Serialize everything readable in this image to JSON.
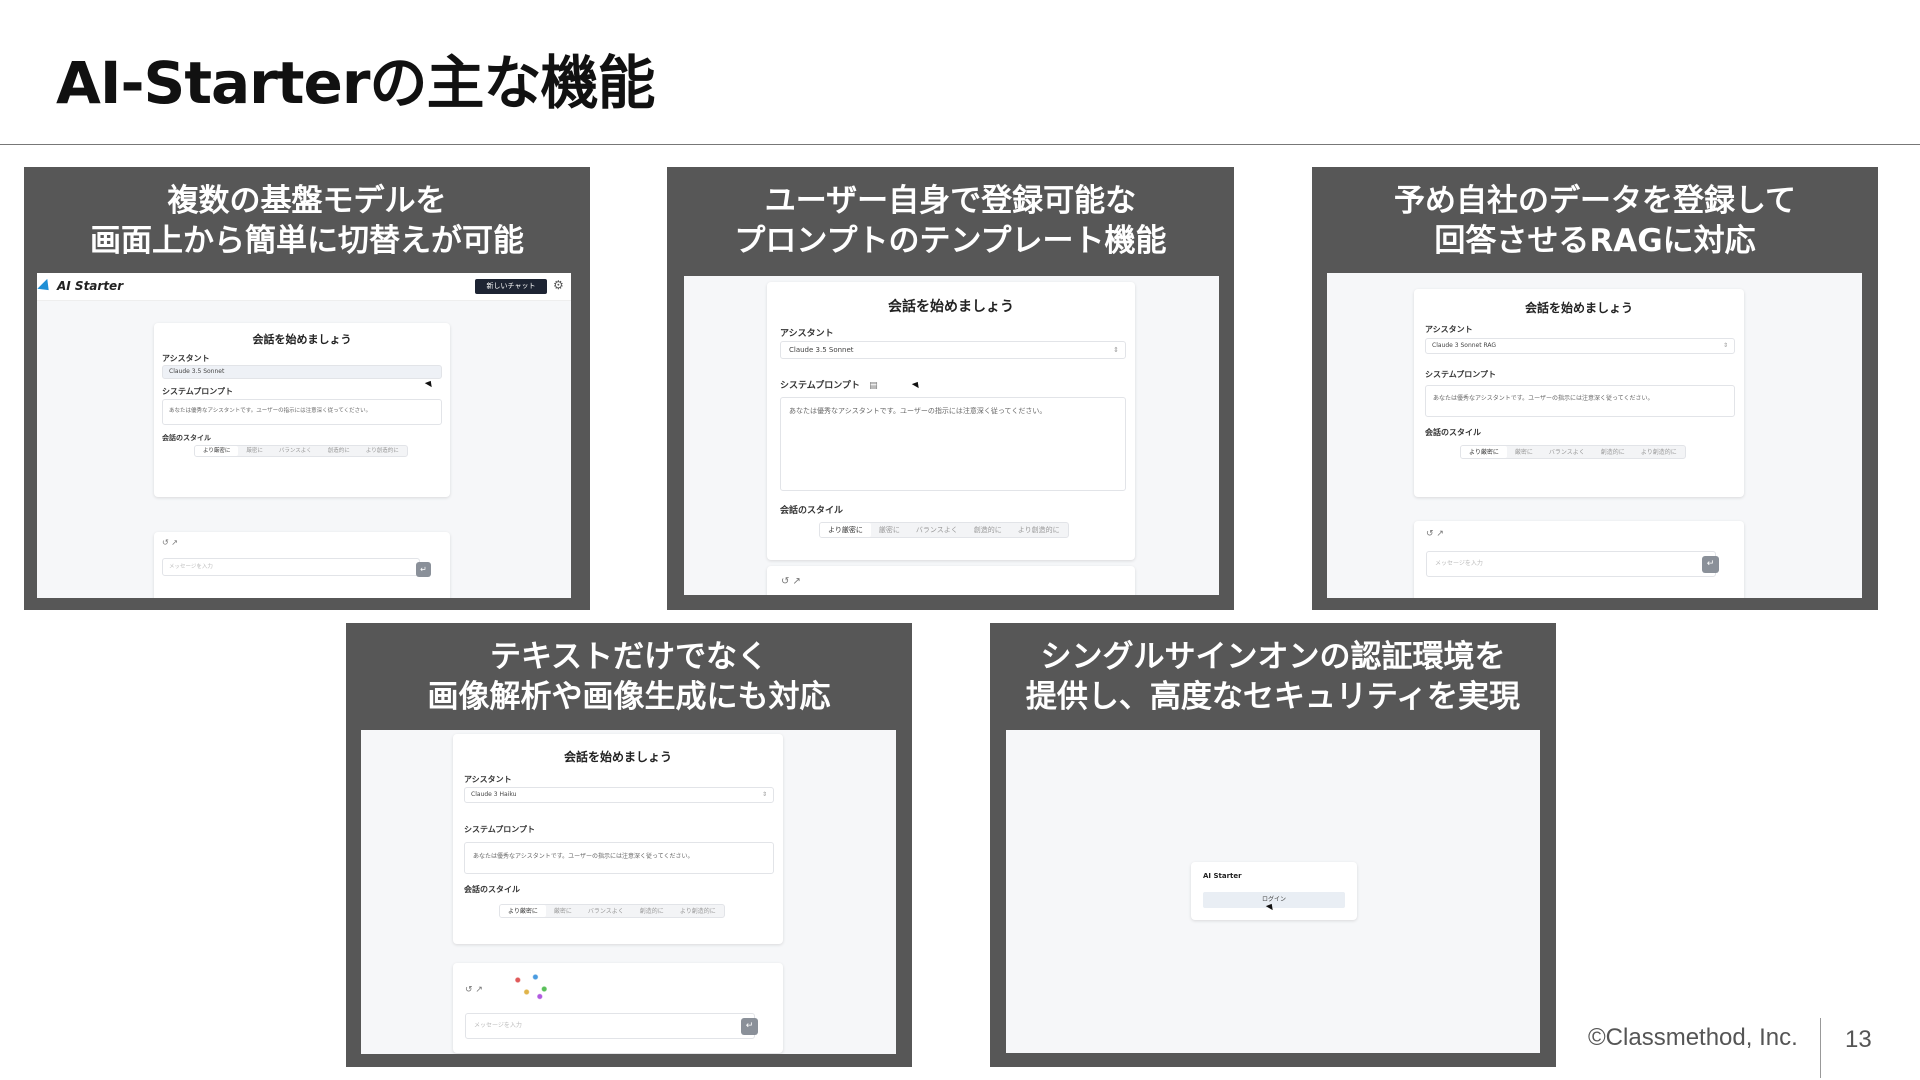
{
  "slide": {
    "title": "AI-Starterの主な機能",
    "footer": "©Classmethod, Inc.",
    "page_number": "13"
  },
  "cards": [
    {
      "heading": [
        "複数の基盤モデルを",
        "画面上から簡単に切替えが可能"
      ],
      "shot": {
        "brand": "AI Starter",
        "new_chat_button": "新しいチャット",
        "mock_title": "会話を始めましょう",
        "assistant_label": "アシスタント",
        "model": "Claude 3.5 Sonnet",
        "prompt_label": "システムプロンプト",
        "prompt_text": "あなたは優秀なアシスタントです。ユーザーの指示には注意深く従ってください。",
        "style_label": "会話のスタイル",
        "styles": [
          "より厳密に",
          "厳密に",
          "バランスよく",
          "創造的に",
          "より創造的に"
        ],
        "input_placeholder": "メッセージを入力"
      }
    },
    {
      "heading": [
        "ユーザー自身で登録可能な",
        "プロンプトのテンプレート機能"
      ],
      "shot": {
        "mock_title": "会話を始めましょう",
        "assistant_label": "アシスタント",
        "model": "Claude 3.5 Sonnet",
        "prompt_label": "システムプロンプト",
        "prompt_text": "あなたは優秀なアシスタントです。ユーザーの指示には注意深く従ってください。",
        "style_label": "会話のスタイル",
        "styles": [
          "より厳密に",
          "厳密に",
          "バランスよく",
          "創造的に",
          "より創造的に"
        ]
      }
    },
    {
      "heading": [
        "予め自社のデータを登録して",
        "回答させるRAGに対応"
      ],
      "shot": {
        "mock_title": "会話を始めましょう",
        "assistant_label": "アシスタント",
        "model": "Claude 3 Sonnet RAG",
        "prompt_label": "システムプロンプト",
        "prompt_text": "あなたは優秀なアシスタントです。ユーザーの指示には注意深く従ってください。",
        "style_label": "会話のスタイル",
        "styles": [
          "より厳密に",
          "厳密に",
          "バランスよく",
          "創造的に",
          "より創造的に"
        ],
        "input_placeholder": "メッセージを入力"
      }
    },
    {
      "heading": [
        "テキストだけでなく",
        "画像解析や画像生成にも対応"
      ],
      "shot": {
        "mock_title": "会話を始めましょう",
        "assistant_label": "アシスタント",
        "model": "Claude 3 Haiku",
        "prompt_label": "システムプロンプト",
        "prompt_text": "あなたは優秀なアシスタントです。ユーザーの指示には注意深く従ってください。",
        "style_label": "会話のスタイル",
        "styles": [
          "より厳密に",
          "厳密に",
          "バランスよく",
          "創造的に",
          "より創造的に"
        ],
        "input_placeholder": "メッセージを入力"
      }
    },
    {
      "heading": [
        "シングルサインオンの認証環境を",
        "提供し、高度なセキュリティを実現"
      ],
      "shot": {
        "brand": "AI Starter",
        "login_button": "ログイン"
      }
    }
  ],
  "colors": {
    "card_bg": "#575757",
    "screenshot_bg": "#f6f7f9",
    "brand_accent": "#1e8fd6",
    "new_chat_bg": "#1d2433"
  }
}
